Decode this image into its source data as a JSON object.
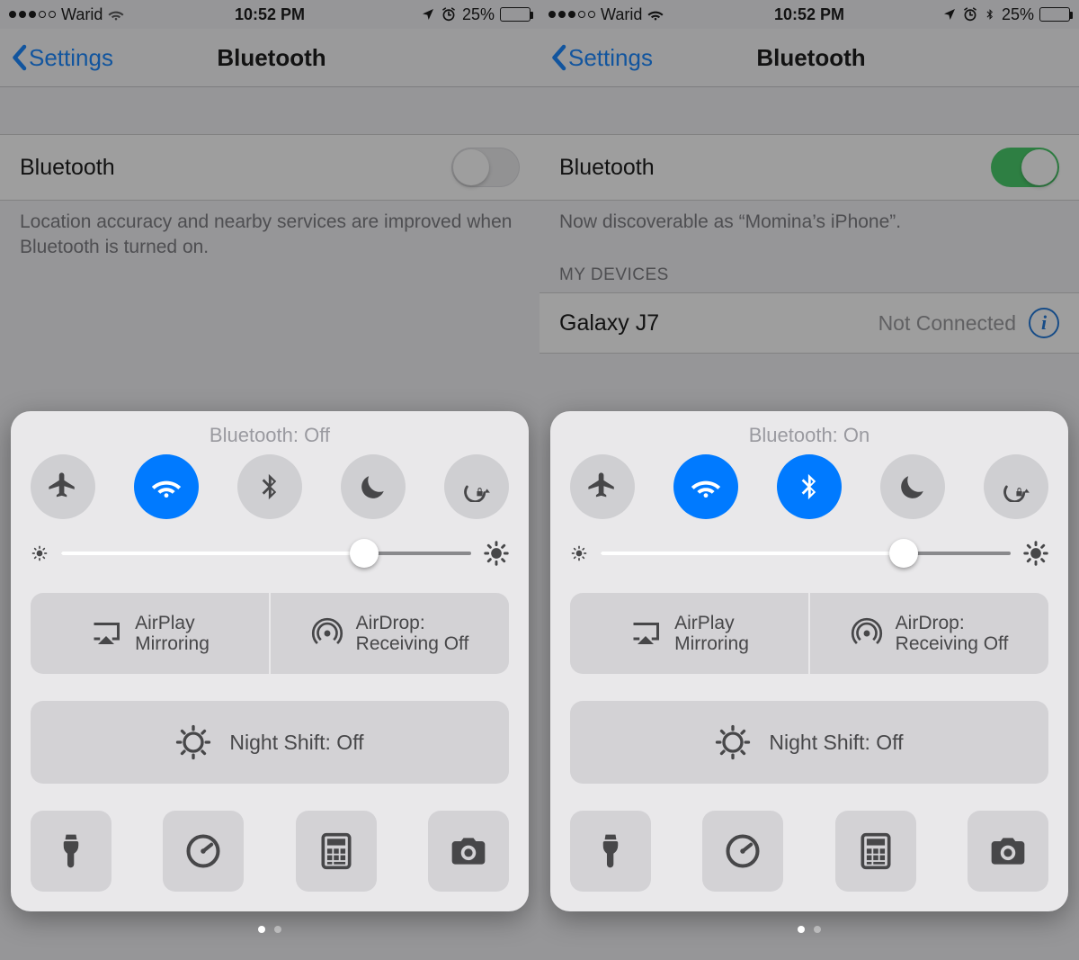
{
  "left": {
    "status": {
      "carrier": "Warid",
      "time": "10:52 PM",
      "battery_pct": "25%",
      "bt_visible": false
    },
    "nav": {
      "back": "Settings",
      "title": "Bluetooth"
    },
    "bt_row_label": "Bluetooth",
    "bt_on": false,
    "desc": "Location accuracy and nearby services are improved when Bluetooth is turned on.",
    "cc": {
      "status": "Bluetooth: Off",
      "brightness": 0.74,
      "airplay": {
        "l1": "AirPlay",
        "l2": "Mirroring"
      },
      "airdrop": {
        "l1": "AirDrop:",
        "l2": "Receiving Off"
      },
      "nightshift": "Night Shift: Off"
    }
  },
  "right": {
    "status": {
      "carrier": "Warid",
      "time": "10:52 PM",
      "battery_pct": "25%",
      "bt_visible": true
    },
    "nav": {
      "back": "Settings",
      "title": "Bluetooth"
    },
    "bt_row_label": "Bluetooth",
    "bt_on": true,
    "desc": "Now discoverable as “Momina’s iPhone”.",
    "sect": "MY DEVICES",
    "device": {
      "name": "Galaxy J7",
      "status": "Not Connected"
    },
    "cc": {
      "status": "Bluetooth: On",
      "brightness": 0.74,
      "airplay": {
        "l1": "AirPlay",
        "l2": "Mirroring"
      },
      "airdrop": {
        "l1": "AirDrop:",
        "l2": "Receiving Off"
      },
      "nightshift": "Night Shift: Off"
    }
  }
}
